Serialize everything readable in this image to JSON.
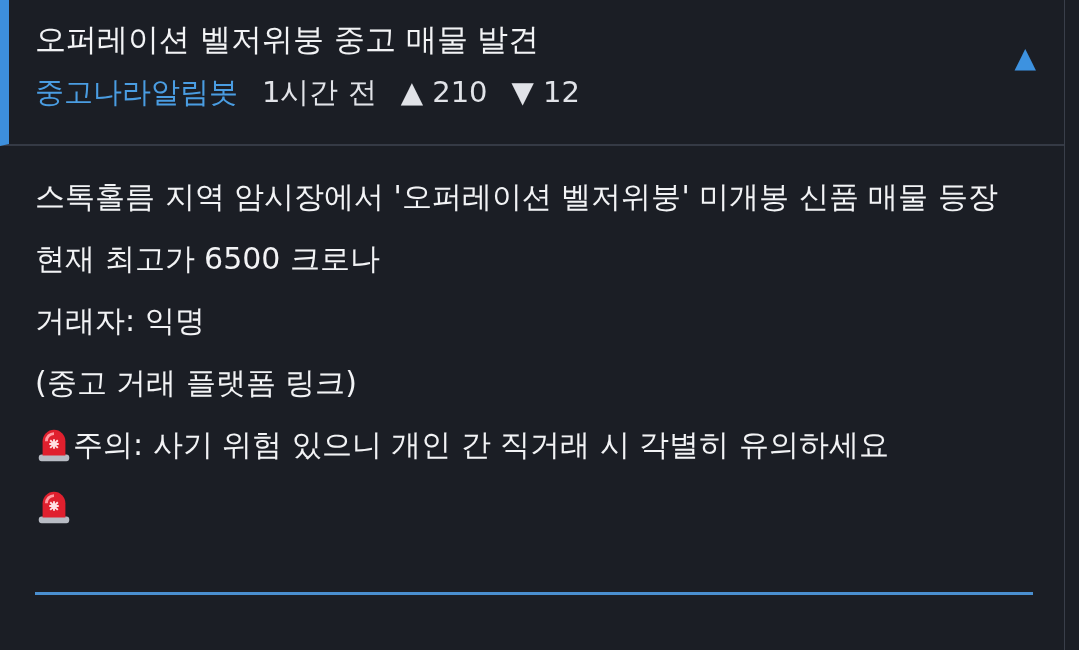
{
  "post": {
    "title": "오퍼레이션 벨저위붕 중고 매물 발견",
    "author": "중고나라알림봇",
    "time": "1시간 전",
    "upvotes": "▲ 210",
    "downvotes": "▼ 12",
    "toggle": "▲",
    "expanded": true
  },
  "body": [
    {
      "kind": "text",
      "text": "스톡홀름 지역 암시장에서 '오퍼레이션 벨저위붕' 미개봉 신품 매물 등장"
    },
    {
      "kind": "text",
      "text": "현재 최고가 6500 크로나"
    },
    {
      "kind": "text",
      "text": "거래자: 익명"
    },
    {
      "kind": "text",
      "text": "(중고 거래 플랫폼 링크)"
    },
    {
      "kind": "alert",
      "text": "주의: 사기 위험 있으니 개인 간 직거래 시 각별히 유의하세요"
    }
  ]
}
